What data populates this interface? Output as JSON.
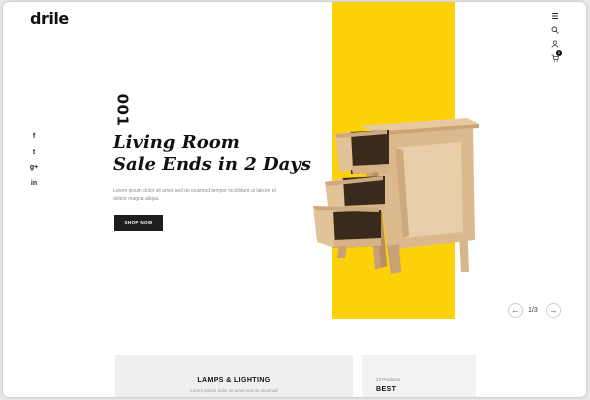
{
  "header": {
    "logo": "drile",
    "icons": [
      "menu-icon",
      "search-icon",
      "user-icon",
      "cart-icon"
    ],
    "cart_count": "0"
  },
  "social": {
    "items": [
      "f",
      "t",
      "g+",
      "in"
    ]
  },
  "hero": {
    "slide_number": "001",
    "title_line1": "Living Room",
    "title_line2": "Sale Ends in 2 Days",
    "description": "Lorem ipsum dolor sit amet sed do eiusmod tempor incididunt ut labore et dolore magna aliqua.",
    "button_label": "SHOP NOW",
    "accent_color": "#fdd10a"
  },
  "slider": {
    "prev_label": "←",
    "next_label": "→",
    "counter": "1/3"
  },
  "cards": {
    "left": {
      "title": "LAMPS & LIGHTING",
      "subtitle": "Lorem ipsum dolor sit amet sed do eiusmod"
    },
    "right": {
      "count": "23 Products",
      "title": "BEST"
    }
  }
}
